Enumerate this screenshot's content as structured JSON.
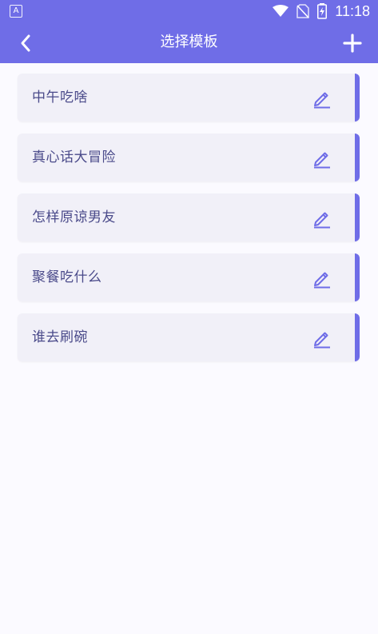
{
  "status_bar": {
    "left_icon": "A",
    "time": "11:18",
    "icons": [
      "wifi-icon",
      "no-sim-icon",
      "battery-charging-icon"
    ]
  },
  "header": {
    "title": "选择模板",
    "back_icon": "chevron-left-icon",
    "add_icon": "plus-icon"
  },
  "templates": [
    {
      "label": "中午吃啥"
    },
    {
      "label": "真心话大冒险"
    },
    {
      "label": "怎样原谅男友"
    },
    {
      "label": "聚餐吃什么"
    },
    {
      "label": "谁去刷碗"
    }
  ],
  "colors": {
    "primary": "#6f6de7",
    "card_bg": "#f1f0f8",
    "text": "#4a4a8a",
    "background": "#fbfaff"
  }
}
